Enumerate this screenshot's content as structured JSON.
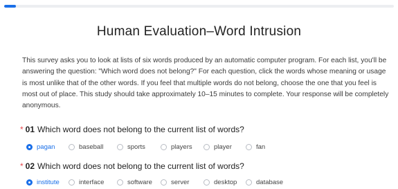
{
  "progress": {
    "fraction": 0.03
  },
  "title": "Human Evaluation–Word Intrusion",
  "intro": "This survey asks you to look at lists of six words produced by an automatic computer program. For each list, you'll be answering the question: \"Which word does not belong?\" For each question, click the words whose meaning or usage is most unlike that of the other words. If you feel that multiple words do not belong, choose the one that you feel is most out of place. This study should take approximately 10–15 minutes to complete. Your response will be completely anonymous.",
  "questions": [
    {
      "required_mark": "*",
      "number": "01",
      "text": "Which word does not belong to the current list of words?",
      "options": [
        "pagan",
        "baseball",
        "sports",
        "players",
        "player",
        "fan"
      ],
      "selected": "pagan"
    },
    {
      "required_mark": "*",
      "number": "02",
      "text": "Which word does not belong to the current list of words?",
      "options": [
        "institute",
        "interface",
        "software",
        "server",
        "desktop",
        "database"
      ],
      "selected": "institute"
    }
  ],
  "colors": {
    "accent": "#1a6fe8",
    "required": "#e5484d"
  }
}
